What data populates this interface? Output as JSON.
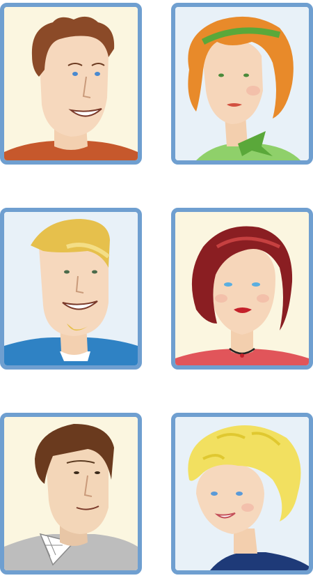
{
  "avatars": [
    {
      "id": "man-brown-spiky-hair",
      "background": "#fbf6e0",
      "frame": "#6f9fd0"
    },
    {
      "id": "woman-red-hair-headband",
      "background": "#e8f1f8",
      "frame": "#6f9fd0"
    },
    {
      "id": "man-blond-hair-blue-shirt",
      "background": "#e8f1f8",
      "frame": "#6f9fd0"
    },
    {
      "id": "woman-dark-red-bob",
      "background": "#fbf6e0",
      "frame": "#6f9fd0"
    },
    {
      "id": "man-brown-hair-plaid-shirt",
      "background": "#fbf6e0",
      "frame": "#6f9fd0"
    },
    {
      "id": "woman-blonde-curly-hair",
      "background": "#e8f1f8",
      "frame": "#6f9fd0"
    }
  ]
}
